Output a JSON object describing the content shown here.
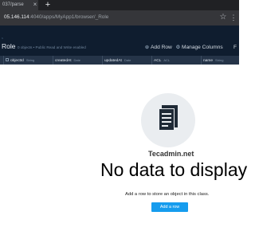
{
  "browser": {
    "tab_title": "037/parse",
    "tab_close": "×",
    "new_tab": "+",
    "url_host": "05.146.114",
    "url_path": ":4040/apps/MyApp1/browser/_Role",
    "star_icon": "bookmark-star-icon",
    "menu_icon": "kebab-menu-icon"
  },
  "header": {
    "prev_crumb": "s",
    "class_name": "Role",
    "class_sub": "0 objects • Public Read and Write enabled",
    "add_row_label": "Add Row",
    "manage_columns_label": "Manage Columns",
    "more_label": "F",
    "bg_color": "#0f1d2f"
  },
  "columns": [
    {
      "name": "objectId",
      "type": "String"
    },
    {
      "name": "createdAt",
      "type": "Date"
    },
    {
      "name": "updatedAt",
      "type": "Date"
    },
    {
      "name": "ACL",
      "type": "ACL"
    },
    {
      "name": "name",
      "type": "String"
    }
  ],
  "empty_state": {
    "icon": "document-icon",
    "watermark": "Tecadmin.net",
    "title": "No data to display",
    "description": "Add a row to store an object in this class.",
    "button_label": "Add a row",
    "button_color": "#169cee"
  }
}
